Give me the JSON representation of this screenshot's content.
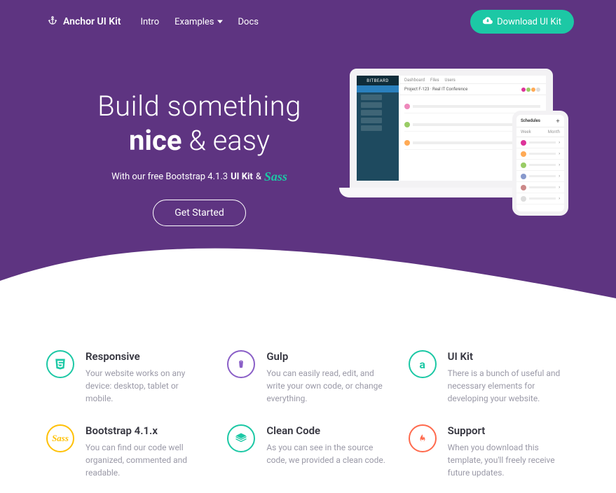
{
  "brand": "Anchor UI Kit",
  "nav": {
    "intro": "Intro",
    "examples": "Examples",
    "docs": "Docs"
  },
  "download": "Download UI Kit",
  "hero": {
    "line1": "Build something",
    "line2_bold": "nice",
    "line2_rest": " & easy",
    "sub_prefix": "With our free Bootstrap 4.1.3 ",
    "sub_bold": "UI Kit",
    "sub_amp": " & ",
    "sub_sass": "Sass",
    "cta": "Get Started"
  },
  "mock": {
    "logo": "BITBEARD",
    "tab1": "Project F-123 · Real IT Conference",
    "phone_title": "Schedules",
    "phone_sub_l": "Week",
    "phone_sub_r": "Month"
  },
  "features": [
    {
      "title": "Responsive",
      "desc": "Your website works on any device: desktop, tablet or mobile."
    },
    {
      "title": "Gulp",
      "desc": "You can easily read, edit, and write your own code, or change everything."
    },
    {
      "title": "UI Kit",
      "desc": "There is a bunch of useful and necessary elements for developing your website."
    },
    {
      "title": "Bootstrap 4.1.x",
      "desc": "You can find our code well organized, commented and readable."
    },
    {
      "title": "Clean Code",
      "desc": "As you can see in the source code, we provided a clean code."
    },
    {
      "title": "Support",
      "desc": "When you download this template, you'll freely receive future updates."
    }
  ]
}
